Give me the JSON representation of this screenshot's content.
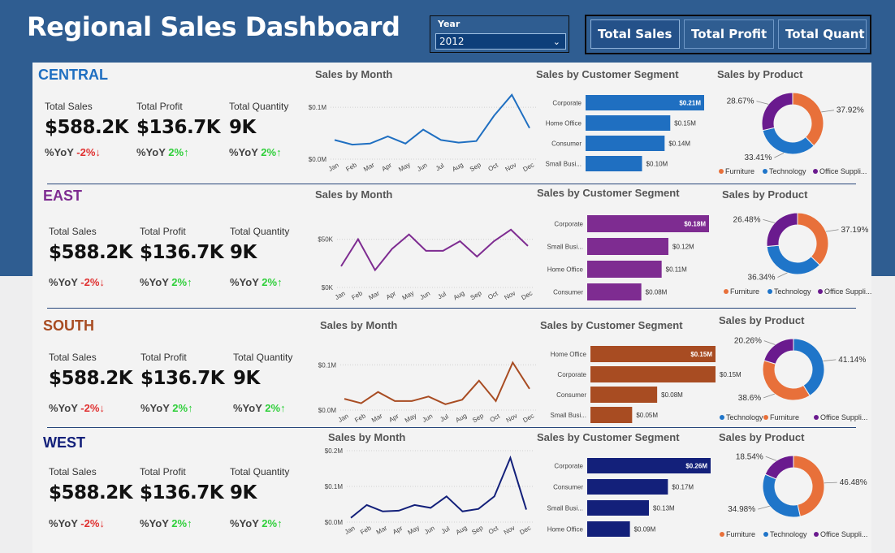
{
  "title": "Regional Sales Dashboard",
  "year_slicer": {
    "label": "Year",
    "value": "2012"
  },
  "measure_buttons": [
    "Total Sales",
    "Total Profit",
    "Total Quant..."
  ],
  "kpi_labels": {
    "sales": "Total Sales",
    "profit": "Total Profit",
    "quantity": "Total Quantity"
  },
  "yoy_prefix": "%YoY",
  "visual_titles": {
    "month": "Sales by Month",
    "segment": "Sales by Customer Segment",
    "product": "Sales by Product"
  },
  "months": [
    "Jan",
    "Feb",
    "Mar",
    "Apr",
    "May",
    "Jun",
    "Jul",
    "Aug",
    "Sep",
    "Oct",
    "Nov",
    "Dec"
  ],
  "colors": {
    "furniture": "#e8703a",
    "technology": "#1f75c9",
    "office_supplies": "#6a1a8e"
  },
  "regions": [
    {
      "key": "central",
      "name": "CENTRAL",
      "color": "#1f6fc1",
      "kpi": {
        "sales": "$588.2K",
        "profit": "$136.7K",
        "quantity": "9K",
        "sales_yoy": "-2%↓",
        "profit_yoy": "2%↑",
        "quantity_yoy": "2%↑"
      },
      "month_chart": {
        "y_ticks": [
          "$0.1M",
          "$0.0M"
        ],
        "tick_values": [
          0.1,
          0.0
        ],
        "ymax": 0.13,
        "values": [
          0.037,
          0.028,
          0.03,
          0.044,
          0.03,
          0.057,
          0.037,
          0.032,
          0.035,
          0.084,
          0.124,
          0.06
        ]
      },
      "segments": [
        {
          "name": "Corporate",
          "value": 0.21,
          "label": "$0.21M"
        },
        {
          "name": "Home Office",
          "value": 0.15,
          "label": "$0.15M"
        },
        {
          "name": "Consumer",
          "value": 0.14,
          "label": "$0.14M"
        },
        {
          "name": "Small Busi...",
          "value": 0.1,
          "label": "$0.10M"
        }
      ],
      "donut": [
        {
          "category": "Furniture",
          "pct": 37.92,
          "label": "37.92%"
        },
        {
          "category": "Technology",
          "pct": 33.41,
          "label": "33.41%"
        },
        {
          "category": "Office Supplies",
          "pct": 28.67,
          "label": "28.67%"
        }
      ],
      "legend": [
        "Furniture",
        "Technology",
        "Office Suppli..."
      ]
    },
    {
      "key": "east",
      "name": "EAST",
      "color": "#7e2c91",
      "kpi": {
        "sales": "$588.2K",
        "profit": "$136.7K",
        "quantity": "9K",
        "sales_yoy": "-2%↓",
        "profit_yoy": "2%↑",
        "quantity_yoy": "2%↑"
      },
      "month_chart": {
        "y_ticks": [
          "$50K",
          "$0K"
        ],
        "tick_values": [
          50,
          0
        ],
        "ymax": 64,
        "values": [
          22,
          50,
          18,
          40,
          55,
          38,
          38,
          48,
          32,
          48,
          60,
          43
        ]
      },
      "segments": [
        {
          "name": "Corporate",
          "value": 0.18,
          "label": "$0.18M"
        },
        {
          "name": "Small Busi...",
          "value": 0.12,
          "label": "$0.12M"
        },
        {
          "name": "Home Office",
          "value": 0.11,
          "label": "$0.11M"
        },
        {
          "name": "Consumer",
          "value": 0.08,
          "label": "$0.08M"
        }
      ],
      "donut": [
        {
          "category": "Furniture",
          "pct": 37.19,
          "label": "37.19%"
        },
        {
          "category": "Technology",
          "pct": 36.34,
          "label": "36.34%"
        },
        {
          "category": "Office Supplies",
          "pct": 26.48,
          "label": "26.48%"
        }
      ],
      "legend": [
        "Furniture",
        "Technology",
        "Office Suppli..."
      ]
    },
    {
      "key": "south",
      "name": "SOUTH",
      "color": "#a84c22",
      "kpi": {
        "sales": "$588.2K",
        "profit": "$136.7K",
        "quantity": "9K",
        "sales_yoy": "-2%↓",
        "profit_yoy": "2%↑",
        "quantity_yoy": "2%↑"
      },
      "month_chart": {
        "y_ticks": [
          "$0.1M",
          "$0.0M"
        ],
        "tick_values": [
          0.1,
          0.0
        ],
        "ymax": 0.122,
        "values": [
          0.025,
          0.015,
          0.04,
          0.02,
          0.02,
          0.03,
          0.013,
          0.023,
          0.065,
          0.02,
          0.105,
          0.047
        ]
      },
      "segments": [
        {
          "name": "Home Office",
          "value": 0.15,
          "label": "$0.15M"
        },
        {
          "name": "Corporate",
          "value": 0.15,
          "label": "$0.15M"
        },
        {
          "name": "Consumer",
          "value": 0.08,
          "label": "$0.08M"
        },
        {
          "name": "Small Busi...",
          "value": 0.05,
          "label": "$0.05M"
        }
      ],
      "donut": [
        {
          "category": "Technology",
          "pct": 41.14,
          "label": "41.14%"
        },
        {
          "category": "Furniture",
          "pct": 38.6,
          "label": "38.6%"
        },
        {
          "category": "Office Supplies",
          "pct": 20.26,
          "label": "20.26%"
        }
      ],
      "legend": [
        "Technology",
        "Furniture",
        "Office Suppli..."
      ]
    },
    {
      "key": "west",
      "name": "WEST",
      "color": "#13207a",
      "kpi": {
        "sales": "$588.2K",
        "profit": "$136.7K",
        "quantity": "9K",
        "sales_yoy": "-2%↓",
        "profit_yoy": "2%↑",
        "quantity_yoy": "2%↑"
      },
      "month_chart": {
        "y_ticks": [
          "$0.2M",
          "$0.1M",
          "$0.0M"
        ],
        "tick_values": [
          0.2,
          0.1,
          0.0
        ],
        "ymax": 0.2,
        "values": [
          0.012,
          0.048,
          0.03,
          0.032,
          0.048,
          0.04,
          0.072,
          0.03,
          0.037,
          0.072,
          0.18,
          0.035
        ]
      },
      "segments": [
        {
          "name": "Corporate",
          "value": 0.26,
          "label": "$0.26M"
        },
        {
          "name": "Consumer",
          "value": 0.17,
          "label": "$0.17M"
        },
        {
          "name": "Small Busi...",
          "value": 0.13,
          "label": "$0.13M"
        },
        {
          "name": "Home Office",
          "value": 0.09,
          "label": "$0.09M"
        }
      ],
      "donut": [
        {
          "category": "Furniture",
          "pct": 46.48,
          "label": "46.48%"
        },
        {
          "category": "Technology",
          "pct": 34.98,
          "label": "34.98%"
        },
        {
          "category": "Office Supplies",
          "pct": 18.54,
          "label": "18.54%"
        }
      ],
      "legend": [
        "Furniture",
        "Technology",
        "Office Suppli..."
      ]
    }
  ]
}
